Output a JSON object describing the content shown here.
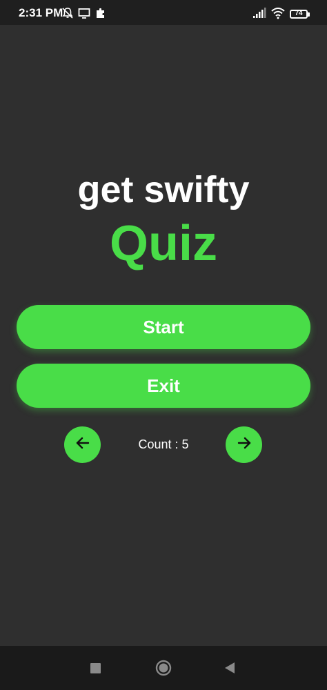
{
  "status_bar": {
    "time": "2:31 PM",
    "battery": "74",
    "icons": [
      "notifications-off-icon",
      "cast-screen-icon",
      "extension-icon",
      "signal-icon",
      "wifi-icon",
      "battery-icon"
    ]
  },
  "title": {
    "app_name": "get swifty",
    "subtitle": "Quiz"
  },
  "buttons": {
    "start_label": "Start",
    "exit_label": "Exit"
  },
  "counter": {
    "label": "Count : 5",
    "prev_icon": "arrow-left-icon",
    "next_icon": "arrow-right-icon"
  },
  "navigation": {
    "icons": [
      "recents-square-icon",
      "home-circle-icon",
      "back-triangle-icon"
    ]
  },
  "colors": {
    "accent": "#49dd48",
    "background": "#2f2f2f",
    "status_bar": "#1f1f1f",
    "nav_bar": "#1a1a1a"
  }
}
